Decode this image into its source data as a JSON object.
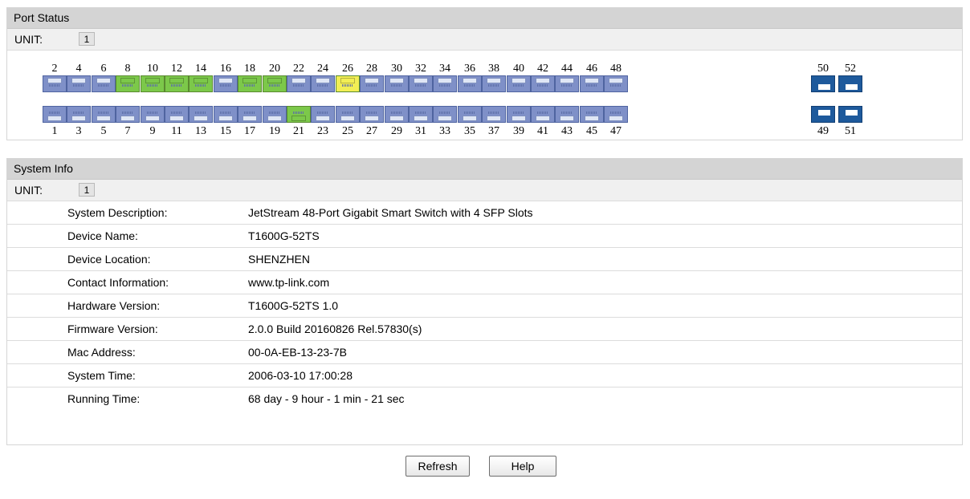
{
  "port_status": {
    "title": "Port Status",
    "unit_label": "UNIT:",
    "unit_value": "1",
    "top_ports": [
      "2",
      "4",
      "6",
      "8",
      "10",
      "12",
      "14",
      "16",
      "18",
      "20",
      "22",
      "24",
      "26",
      "28",
      "30",
      "32",
      "34",
      "36",
      "38",
      "40",
      "42",
      "44",
      "46",
      "48"
    ],
    "bottom_ports": [
      "1",
      "3",
      "5",
      "7",
      "9",
      "11",
      "13",
      "15",
      "17",
      "19",
      "21",
      "23",
      "25",
      "27",
      "29",
      "31",
      "33",
      "35",
      "37",
      "39",
      "41",
      "43",
      "45",
      "47"
    ],
    "sfp_top": [
      "50",
      "52"
    ],
    "sfp_bottom": [
      "49",
      "51"
    ],
    "port_states": {
      "8": "green",
      "10": "green",
      "12": "green",
      "14": "green",
      "18": "green",
      "20": "green",
      "21": "green",
      "26": "yellow"
    },
    "colors": {
      "down": "#7f90c8",
      "green": "#7cc84a",
      "yellow": "#f2ee55",
      "sfp": "#1e5a9c"
    }
  },
  "system_info": {
    "title": "System Info",
    "unit_label": "UNIT:",
    "unit_value": "1",
    "rows": [
      {
        "label": "System Description:",
        "value": "JetStream 48-Port Gigabit Smart Switch with 4 SFP Slots"
      },
      {
        "label": "Device Name:",
        "value": "T1600G-52TS"
      },
      {
        "label": "Device Location:",
        "value": "SHENZHEN"
      },
      {
        "label": "Contact Information:",
        "value": "www.tp-link.com"
      },
      {
        "label": "Hardware Version:",
        "value": "T1600G-52TS 1.0"
      },
      {
        "label": "Firmware Version:",
        "value": "2.0.0 Build 20160826 Rel.57830(s)"
      },
      {
        "label": "Mac Address:",
        "value": "00-0A-EB-13-23-7B"
      },
      {
        "label": "System Time:",
        "value": "2006-03-10 17:00:28"
      },
      {
        "label": "Running Time:",
        "value": "68 day - 9 hour - 1 min - 21 sec"
      }
    ]
  },
  "buttons": {
    "refresh": "Refresh",
    "help": "Help"
  }
}
